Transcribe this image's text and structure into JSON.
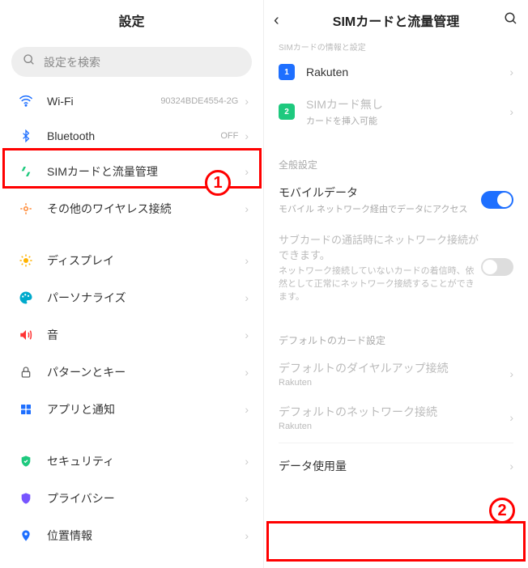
{
  "left": {
    "title": "設定",
    "search_placeholder": "設定を検索",
    "items": {
      "wifi": {
        "label": "Wi-Fi",
        "value": "90324BDE4554-2G"
      },
      "bluetooth": {
        "label": "Bluetooth",
        "value": "OFF"
      },
      "sim": {
        "label": "SIMカードと流量管理"
      },
      "wireless": {
        "label": "その他のワイヤレス接続"
      },
      "display": {
        "label": "ディスプレイ"
      },
      "personalize": {
        "label": "パーソナライズ"
      },
      "sound": {
        "label": "音"
      },
      "pattern": {
        "label": "パターンとキー"
      },
      "apps": {
        "label": "アプリと通知"
      },
      "security": {
        "label": "セキュリティ"
      },
      "privacy": {
        "label": "プライバシー"
      },
      "location": {
        "label": "位置情報"
      }
    }
  },
  "right": {
    "title": "SIMカードと流量管理",
    "faded_header": "SIMカードの情報と設定",
    "sim1": {
      "num": "1",
      "label": "Rakuten"
    },
    "sim2": {
      "num": "2",
      "label": "SIMカード無し",
      "sub": "カードを挿入可能"
    },
    "section_general": "全般設定",
    "mobile_data": {
      "title": "モバイルデータ",
      "sub": "モバイル ネットワーク経由でデータにアクセス"
    },
    "subcard": {
      "title": "サブカードの通話時にネットワーク接続ができます。",
      "sub": "ネットワーク接続していないカードの着信時、依然として正常にネットワーク接続することができます。"
    },
    "section_default": "デフォルトのカード設定",
    "dialup": {
      "title": "デフォルトのダイヤルアップ接続",
      "sub": "Rakuten"
    },
    "network": {
      "title": "デフォルトのネットワーク接続",
      "sub": "Rakuten"
    },
    "data_usage": {
      "title": "データ使用量"
    }
  },
  "badges": {
    "one": "1",
    "two": "2"
  }
}
